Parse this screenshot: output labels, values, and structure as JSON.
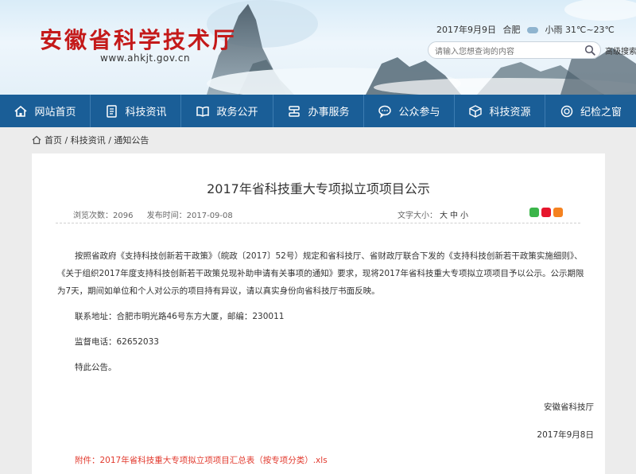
{
  "header": {
    "title": "安徽省科学技术厅",
    "url": "www.ahkjt.gov.cn",
    "date": "2017年9月9日",
    "city": "合肥",
    "weather": "小雨 31℃~23℃",
    "search_placeholder": "请输入您想查询的内容",
    "advanced_search": "高级搜索"
  },
  "nav": {
    "items": [
      {
        "label": "网站首页",
        "icon": "home-icon"
      },
      {
        "label": "科技资讯",
        "icon": "document-icon"
      },
      {
        "label": "政务公开",
        "icon": "book-icon"
      },
      {
        "label": "办事服务",
        "icon": "service-icon"
      },
      {
        "label": "公众参与",
        "icon": "chat-icon"
      },
      {
        "label": "科技资源",
        "icon": "cube-icon"
      },
      {
        "label": "纪检之窗",
        "icon": "badge-icon"
      }
    ]
  },
  "breadcrumb": {
    "home": "首页",
    "sep1": " / ",
    "section": "科技资讯",
    "sep2": " / ",
    "current": "通知公告"
  },
  "article": {
    "title": "2017年省科技重大专项拟立项项目公示",
    "views": "浏览次数：2096",
    "published": "发布时间：2017-09-08",
    "font_size_label": "文字大小：",
    "font_large": "大",
    "font_medium": "中",
    "font_small": "小",
    "paragraph1": "按照省政府《支持科技创新若干政策》（皖政〔2017〕52号）规定和省科技厅、省财政厅联合下发的《支持科技创新若干政策实施细则》、《关于组织2017年度支持科技创新若干政策兑现补助申请有关事项的通知》要求，现将2017年省科技重大专项拟立项项目予以公示。公示期限为7天，期间如单位和个人对公示的项目持有异议，请以真实身份向省科技厅书面反映。",
    "contact": "联系地址：合肥市明光路46号东方大厦，邮编：230011",
    "phone": "监督电话：62652033",
    "notice": "特此公告。",
    "signature": "安徽省科技厅",
    "sign_date": "2017年9月8日",
    "attachment": "附件：2017年省科技重大专项拟立项项目汇总表（按专项分类）.xls"
  },
  "colors": {
    "nav_bg": "#1a5e97",
    "title_red": "#c41a1a",
    "attachment_red": "#e23a2e"
  }
}
